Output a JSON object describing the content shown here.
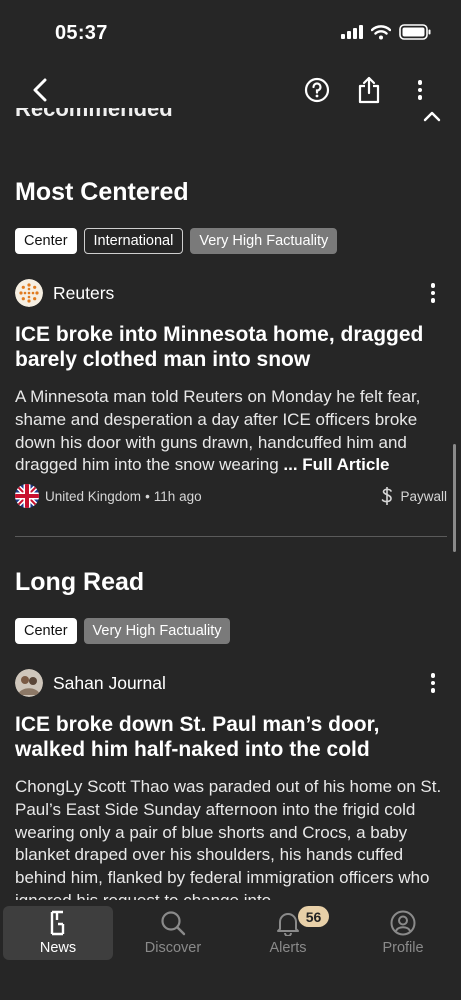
{
  "status": {
    "time": "05:37"
  },
  "prev_section": {
    "title": "Recommended"
  },
  "most_centered": {
    "heading": "Most Centered",
    "chips": [
      "Center",
      "International",
      "Very High Factuality"
    ],
    "source": "Reuters",
    "headline": "ICE broke into Minnesota home, dragged barely clothed man into snow",
    "summary": "A Minnesota man told Reuters on Monday he felt fear, shame and desperation a day after ICE officers broke down his door with guns drawn, handcuffed him and dragged him into the snow wearing",
    "full_article": "... Full Article",
    "location": "United Kingdom",
    "time_ago": "11h ago",
    "paywall": "Paywall"
  },
  "long_read": {
    "heading": "Long Read",
    "chips": [
      "Center",
      "Very High Factuality"
    ],
    "source": "Sahan Journal",
    "headline": "ICE broke down St. Paul man’s door, walked him half-naked into the cold",
    "summary": "ChongLy Scott Thao was paraded out of his home on St. Paul’s East Side Sunday afternoon into the frigid cold wearing only a pair of blue shorts and Crocs, a baby blanket draped over his shoulders, his hands cuffed behind him, flanked by federal immigration officers who ignored his request to change into"
  },
  "tabs": [
    {
      "label": "News",
      "icon": "ground-news-logo-icon",
      "active": true
    },
    {
      "label": "Discover",
      "icon": "search-icon"
    },
    {
      "label": "Alerts",
      "icon": "bell-icon",
      "badge": "56"
    },
    {
      "label": "Profile",
      "icon": "profile-icon"
    }
  ],
  "colors": {
    "background": "#262626",
    "chip_gray": "#7a7a7a",
    "badge": "#e8d0a8"
  }
}
